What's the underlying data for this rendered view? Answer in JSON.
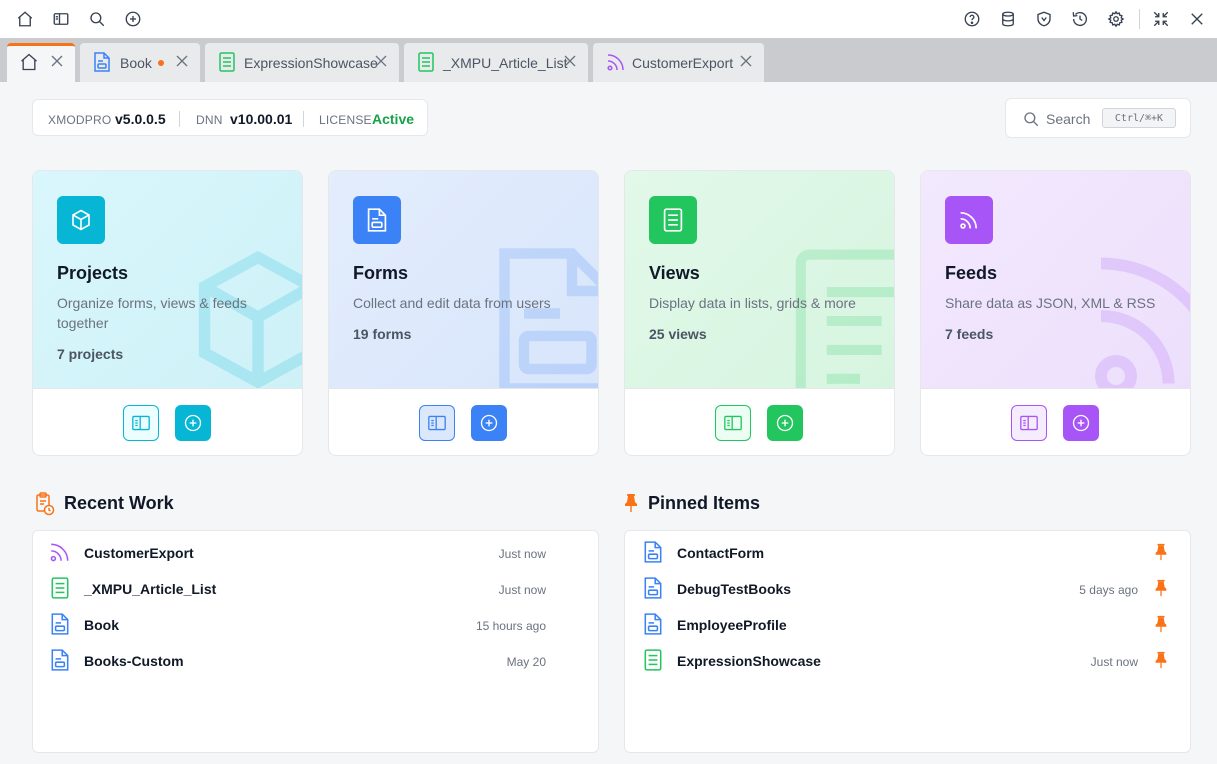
{
  "colors": {
    "accent": "#f97316",
    "projects": "#06b6d4",
    "forms": "#3b82f6",
    "views": "#22c55e",
    "feeds": "#a855f7",
    "active": "#16a34a"
  },
  "toolbar": {
    "left": [
      "home-icon",
      "panel-icon",
      "search-icon",
      "plus-circle-icon"
    ],
    "right": [
      "help-icon",
      "database-icon",
      "shield-icon",
      "history-icon",
      "gear-icon",
      "collapse-icon",
      "close-icon"
    ]
  },
  "tabs": [
    {
      "label": "",
      "icon": "home-icon",
      "active": true
    },
    {
      "label": "Book",
      "icon": "form-icon",
      "modified": true
    },
    {
      "label": "ExpressionShowcase",
      "icon": "view-icon"
    },
    {
      "label": "_XMPU_Article_List",
      "icon": "view-icon"
    },
    {
      "label": "CustomerExport",
      "icon": "feed-icon"
    }
  ],
  "version": {
    "xmod_key": "XMODPRO",
    "xmod_val": "v5.0.0.5",
    "dnn_key": "DNN",
    "dnn_val": "v10.00.01",
    "license_key": "LICENSE",
    "license_val": "Active"
  },
  "search": {
    "placeholder": "Search",
    "shortcut": "Ctrl/⌘+K"
  },
  "cards": [
    {
      "title": "Projects",
      "desc": "Organize forms, views & feeds together",
      "count": "7 projects",
      "icon": "cube-icon"
    },
    {
      "title": "Forms",
      "desc": "Collect and edit data from users",
      "count": "19 forms",
      "icon": "form-icon"
    },
    {
      "title": "Views",
      "desc": "Display data in lists, grids & more",
      "count": "25 views",
      "icon": "view-icon"
    },
    {
      "title": "Feeds",
      "desc": "Share data as JSON, XML & RSS",
      "count": "7 feeds",
      "icon": "feed-icon"
    }
  ],
  "recent": {
    "title": "Recent Work",
    "items": [
      {
        "name": "CustomerExport",
        "time": "Just now",
        "type": "feed"
      },
      {
        "name": "_XMPU_Article_List",
        "time": "Just now",
        "type": "view"
      },
      {
        "name": "Book",
        "time": "15 hours ago",
        "type": "form"
      },
      {
        "name": "Books-Custom",
        "time": "May 20",
        "type": "form"
      }
    ]
  },
  "pinned": {
    "title": "Pinned Items",
    "items": [
      {
        "name": "ContactForm",
        "time": "",
        "type": "form"
      },
      {
        "name": "DebugTestBooks",
        "time": "5 days ago",
        "type": "form"
      },
      {
        "name": "EmployeeProfile",
        "time": "",
        "type": "form"
      },
      {
        "name": "ExpressionShowcase",
        "time": "Just now",
        "type": "view"
      }
    ]
  }
}
